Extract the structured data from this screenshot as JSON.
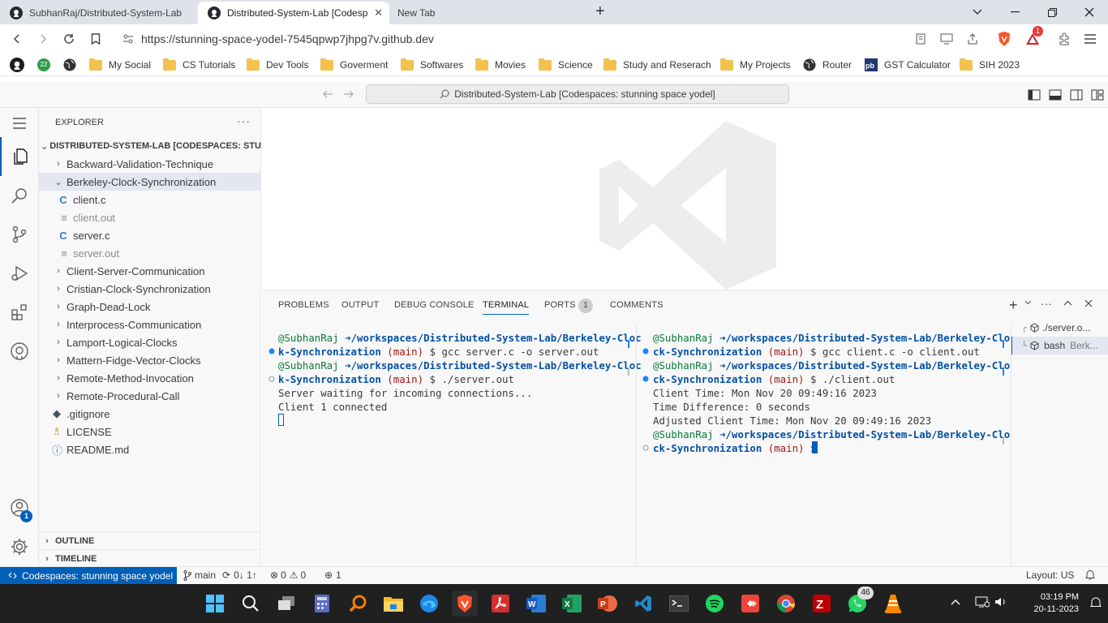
{
  "browser": {
    "tabs": [
      {
        "title": "SubhanRaj/Distributed-System-Lab",
        "active": false
      },
      {
        "title": "Distributed-System-Lab [Codesp",
        "active": true
      },
      {
        "title": "New Tab",
        "active": false
      }
    ],
    "url": "https://stunning-space-yodel-7545qpwp7jhpg7v.github.dev",
    "brave_badge": "1",
    "bookmarks": [
      {
        "label": "",
        "icon": "github-icon"
      },
      {
        "label": "",
        "icon": "counter-icon",
        "badge": "22"
      },
      {
        "label": "",
        "icon": "globe-icon"
      },
      {
        "label": "My Social",
        "icon": "folder-icon"
      },
      {
        "label": "CS Tutorials",
        "icon": "folder-icon"
      },
      {
        "label": "Dev Tools",
        "icon": "folder-icon"
      },
      {
        "label": "Goverment",
        "icon": "folder-icon"
      },
      {
        "label": "Softwares",
        "icon": "folder-icon"
      },
      {
        "label": "Movies",
        "icon": "folder-icon"
      },
      {
        "label": "Science",
        "icon": "folder-icon"
      },
      {
        "label": "Study and Reserach",
        "icon": "folder-icon"
      },
      {
        "label": "My Projects",
        "icon": "folder-icon"
      },
      {
        "label": "Router",
        "icon": "globe-icon"
      },
      {
        "label": "GST Calculator",
        "icon": "pdf-icon"
      },
      {
        "label": "SIH 2023",
        "icon": "folder-icon"
      }
    ]
  },
  "vscode": {
    "command_center": "Distributed-System-Lab [Codespaces: stunning space yodel]",
    "accounts_badge": "1",
    "explorer": {
      "title": "EXPLORER",
      "root": "DISTRIBUTED-SYSTEM-LAB [CODESPACES: STU...",
      "items": [
        {
          "label": "Backward-Validation-Technique",
          "kind": "folder",
          "level": 1
        },
        {
          "label": "Berkeley-Clock-Synchronization",
          "kind": "folder-open",
          "level": 1
        },
        {
          "label": "client.c",
          "kind": "c",
          "level": 2
        },
        {
          "label": "client.out",
          "kind": "out",
          "level": 2
        },
        {
          "label": "server.c",
          "kind": "c",
          "level": 2
        },
        {
          "label": "server.out",
          "kind": "out",
          "level": 2
        },
        {
          "label": "Client-Server-Communication",
          "kind": "folder",
          "level": 1
        },
        {
          "label": "Cristian-Clock-Synchronization",
          "kind": "folder",
          "level": 1
        },
        {
          "label": "Graph-Dead-Lock",
          "kind": "folder",
          "level": 1
        },
        {
          "label": "Interprocess-Communication",
          "kind": "folder",
          "level": 1
        },
        {
          "label": "Lamport-Logical-Clocks",
          "kind": "folder",
          "level": 1
        },
        {
          "label": "Mattern-Fidge-Vector-Clocks",
          "kind": "folder",
          "level": 1
        },
        {
          "label": "Remote-Method-Invocation",
          "kind": "folder",
          "level": 1
        },
        {
          "label": "Remote-Procedural-Call",
          "kind": "folder",
          "level": 1
        },
        {
          "label": ".gitignore",
          "kind": "git",
          "level": 1
        },
        {
          "label": "LICENSE",
          "kind": "license",
          "level": 1
        },
        {
          "label": "README.md",
          "kind": "info",
          "level": 1
        }
      ],
      "outline": "OUTLINE",
      "timeline": "TIMELINE"
    },
    "panel": {
      "tabs": [
        "PROBLEMS",
        "OUTPUT",
        "DEBUG CONSOLE",
        "TERMINAL",
        "PORTS",
        "COMMENTS"
      ],
      "ports_badge": "1",
      "active_tab": "TERMINAL",
      "terminal_left": {
        "user": "@SubhanRaj",
        "arrow": "➜",
        "path_a": "/workspaces/Distributed-System-Lab/Berkeley-Cloc",
        "path_b": "k-Synchronization",
        "branch": "(main)",
        "cmd1": "$ gcc server.c -o server.out",
        "cmd2": "$ ./server.out",
        "out1": "Server waiting for incoming connections...",
        "out2": "Client 1 connected"
      },
      "terminal_right": {
        "user": "@SubhanRaj",
        "arrow": "➜",
        "path_a": "/workspaces/Distributed-System-Lab/Berkeley-Clo",
        "path_b": "ck-Synchronization",
        "branch": "(main)",
        "cmd1": "$ gcc client.c -o client.out",
        "cmd2": "$ ./client.out",
        "out1": "Client Time: Mon Nov 20 09:49:16 2023",
        "out2": "Time Difference: 0 seconds",
        "out3": "Adjusted Client Time: Mon Nov 20 09:49:16 2023",
        "cmd3": "$"
      },
      "terminal_list": [
        {
          "label": "./server.o..."
        },
        {
          "label": "bash",
          "detail": "Berk..."
        }
      ]
    },
    "statusbar": {
      "remote": "Codespaces: stunning space yodel",
      "branch": "main",
      "sync": "0↓ 1↑",
      "errors": "0",
      "warnings": "0",
      "ports": "1",
      "layout": "Layout: US"
    }
  },
  "taskbar": {
    "time": "03:19 PM",
    "date": "20-11-2023",
    "whatsapp_badge": "46",
    "apps": [
      "windows-start",
      "search",
      "task-view",
      "calculator",
      "search-tool",
      "file-explorer",
      "edge",
      "brave",
      "acrobat",
      "word",
      "excel",
      "powerpoint",
      "vscode",
      "terminal",
      "spotify",
      "anydesk",
      "chrome",
      "filezilla",
      "whatsapp",
      "vlc"
    ]
  }
}
